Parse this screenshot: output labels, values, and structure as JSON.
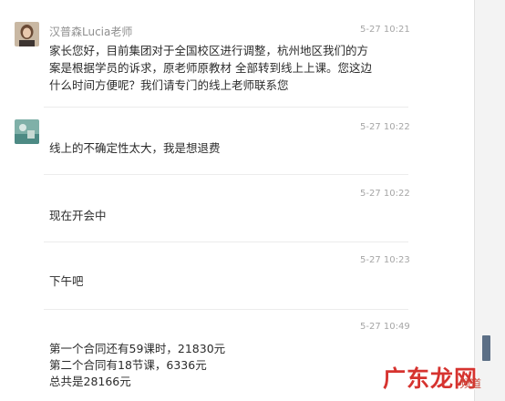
{
  "messages": [
    {
      "sender": "汉普森Lucia老师",
      "time": "5-27 10:21",
      "lines": [
        "家长您好，目前集团对于全国校区进行调整，杭州地区我们的方",
        "案是根据学员的诉求，原老师原教材 全部转到线上上课。您这边",
        "什么时间方便呢？我们请专门的线上老师联系您"
      ]
    },
    {
      "sender": "",
      "time": "5-27 10:22",
      "lines": [
        "线上的不确定性太大，我是想退费"
      ]
    },
    {
      "sender": "",
      "time": "5-27 10:22",
      "lines": [
        "现在开会中"
      ]
    },
    {
      "sender": "",
      "time": "5-27 10:23",
      "lines": [
        "下午吧"
      ]
    },
    {
      "sender": "",
      "time": "5-27 10:49",
      "lines": [
        "第一个合同还有59课时，21830元",
        "第二个合同有18节课，6336元",
        "总共是28166元"
      ]
    }
  ],
  "watermark": {
    "main": "广东龙网",
    "small": "频道"
  },
  "colors": {
    "watermark_red": "#d6332f",
    "scroll_thumb": "#5c6f86"
  }
}
